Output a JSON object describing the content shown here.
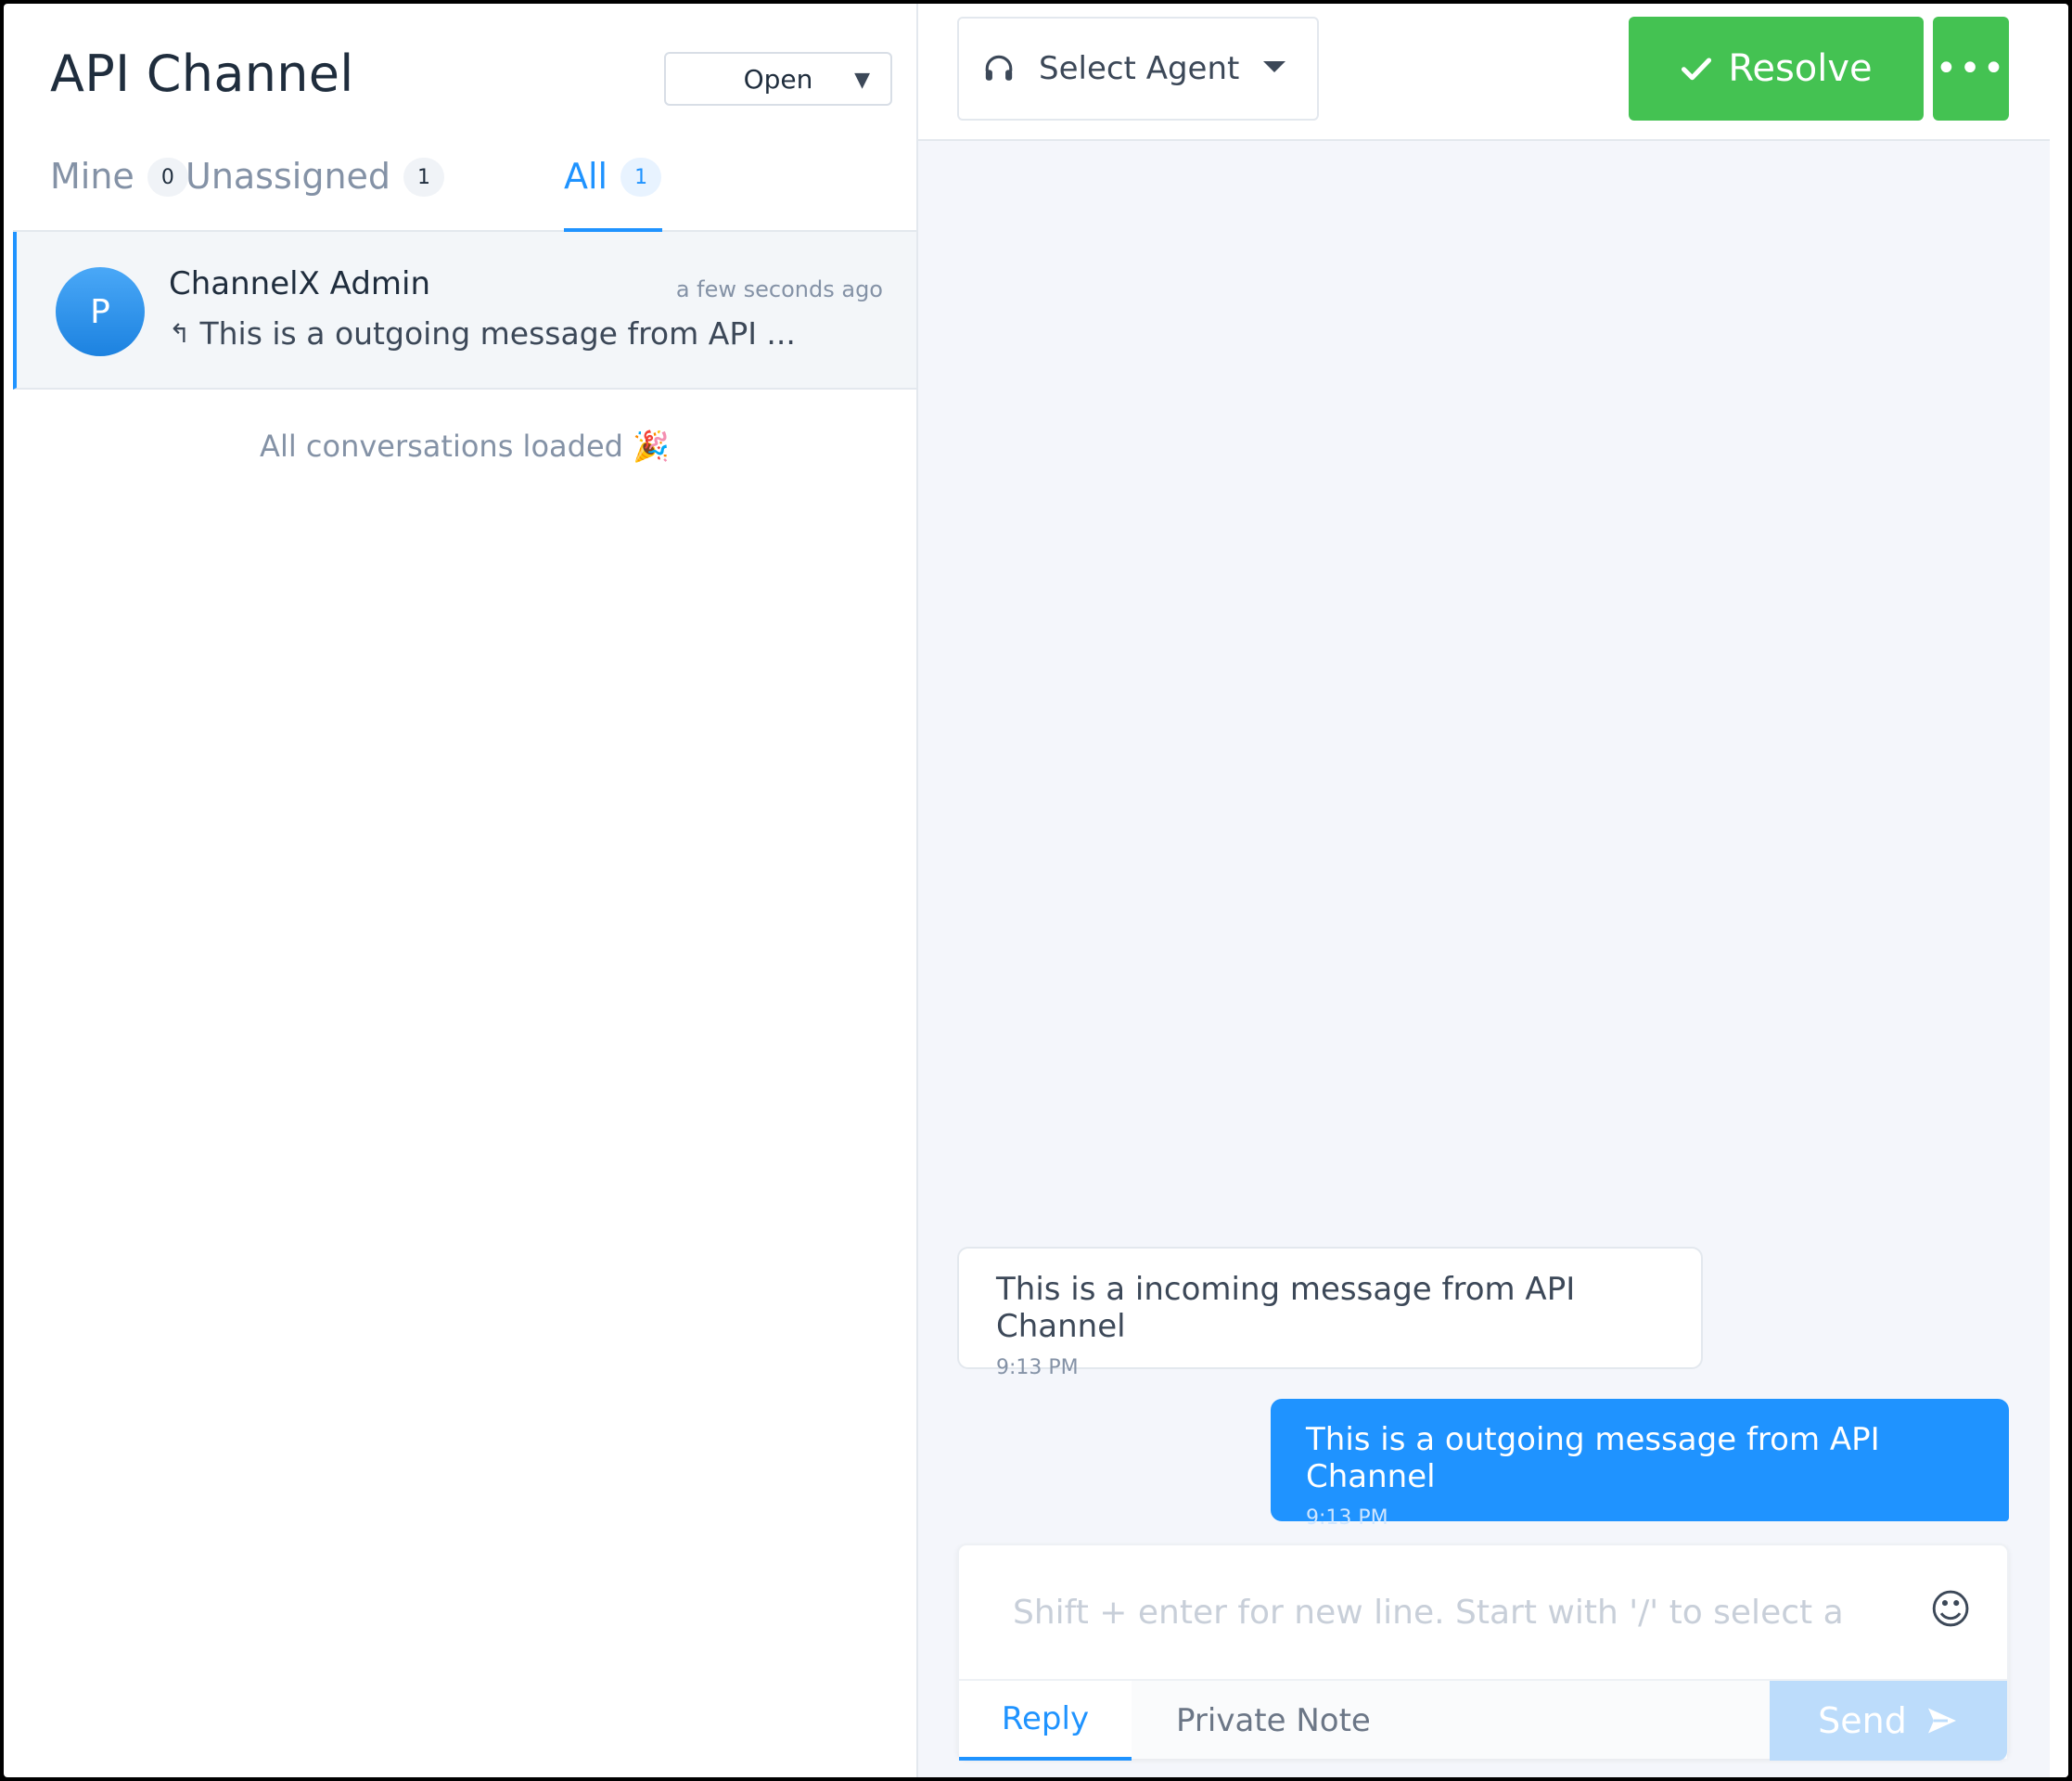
{
  "sidebar": {
    "title": "API Channel",
    "status_filter": "Open",
    "tabs": [
      {
        "label": "Mine",
        "count": "0"
      },
      {
        "label": "Unassigned",
        "count": "1"
      },
      {
        "label": "All",
        "count": "1"
      }
    ],
    "active_tab": "All",
    "conversations": [
      {
        "avatar_initial": "P",
        "name": "ChannelX Admin",
        "time": "a few seconds ago",
        "preview": "This is a outgoing message from API ..."
      }
    ],
    "loaded_text": "All conversations loaded 🎉"
  },
  "header": {
    "agent_placeholder": "Select Agent",
    "resolve_label": "Resolve",
    "more_label": "•••"
  },
  "messages": [
    {
      "direction": "incoming",
      "text": "This is a incoming message from API Channel",
      "time": "9:13 PM"
    },
    {
      "direction": "outgoing",
      "text": "This is a outgoing message from API Channel",
      "time": "9:13 PM"
    }
  ],
  "composer": {
    "placeholder": "Shift + enter for new line. Start with '/' to select a",
    "reply_tab": "Reply",
    "note_tab": "Private Note",
    "send_label": "Send"
  },
  "colors": {
    "accent": "#1f93ff",
    "resolve": "#44c252",
    "send_disabled": "#bcdcfb"
  }
}
